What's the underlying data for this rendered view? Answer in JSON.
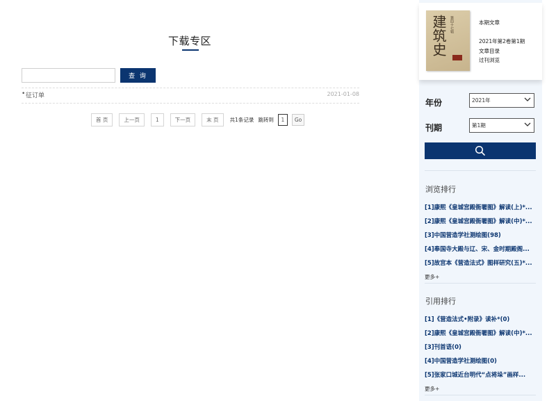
{
  "main": {
    "title": "下载专区",
    "search": {
      "value": "",
      "button_label": "查 询"
    },
    "rows": [
      {
        "name": "征订单",
        "date": "2021-01-08"
      }
    ],
    "pager": {
      "first": "首 页",
      "prev": "上一页",
      "current": "1",
      "next": "下一页",
      "last": "末 页",
      "total": "共1条记录",
      "jump": "跳转到",
      "jump_value": "1",
      "go": "Go"
    }
  },
  "sidebar": {
    "card": {
      "cover_title": "建筑史",
      "cover_subtitle": "第四十七辑",
      "heading": "本期文章",
      "issue": "2021年第2卷第1期",
      "toc": "文章目录",
      "past": "过刊浏览"
    },
    "year_label": "年份",
    "year_value": "2021年",
    "issue_label": "刊期",
    "issue_value": "第1期",
    "search_icon": "search-icon",
    "browse_title": "浏览排行",
    "browse": [
      "[1]康熙《皇城宫殿衙署图》解读(上)*...",
      "[2]康熙《皇城宫殿衙署图》解读(中)*...",
      "[3]中国营造学社测绘图(98)",
      "[4]奉国寺大殿与辽、宋、金时期殿阁...",
      "[5]故宫本《营造法式》图样研究(五)*..."
    ],
    "browse_more": "更多+",
    "cite_title": "引用排行",
    "cite": [
      "[1]《营造法式•附录》读补*(0)",
      "[2]康熙《皇城宫殿衙署图》解读(中)*...",
      "[3]刊首语(0)",
      "[4]中国营造学社测绘图(0)",
      "[5]张家口城近台明代“点将垛”画样..."
    ],
    "cite_more": "更多+"
  },
  "colors": {
    "accent": "#0b3570",
    "sidebar_bg": "#f1f6fc"
  }
}
